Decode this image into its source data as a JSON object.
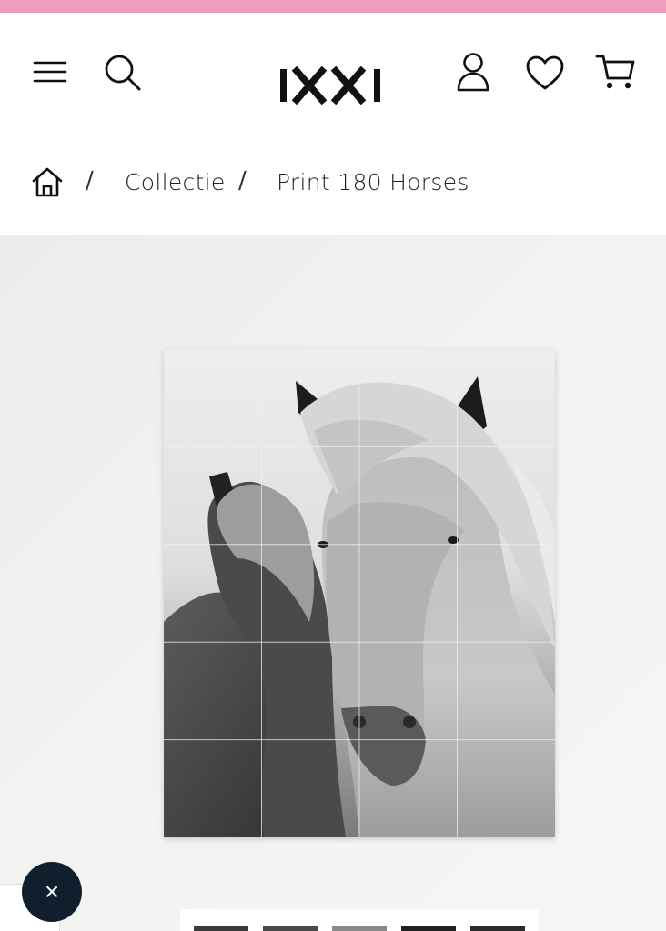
{
  "colors": {
    "topbar": "#f29bc0",
    "dark": "#0f1f2e"
  },
  "header": {
    "logo_text": "IXXI",
    "icons": [
      "menu-icon",
      "search-icon",
      "account-icon",
      "heart-icon",
      "cart-icon"
    ]
  },
  "breadcrumb": {
    "separator": "/",
    "items": [
      "Collectie",
      "Print 180 Horses"
    ]
  },
  "product": {
    "image_alt": "Horses"
  },
  "fab": {
    "label": "×"
  }
}
